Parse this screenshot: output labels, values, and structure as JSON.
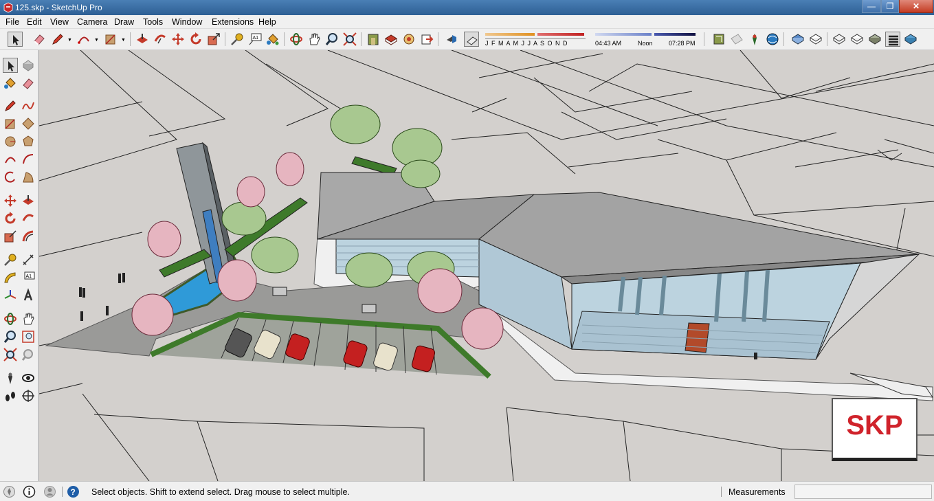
{
  "window": {
    "title": "125.skp - SketchUp Pro",
    "controls": [
      "minimize-icon",
      "maximize-icon",
      "close-icon"
    ]
  },
  "menu": [
    "File",
    "Edit",
    "View",
    "Camera",
    "Draw",
    "Tools",
    "Window",
    "Extensions",
    "Help"
  ],
  "shadows": {
    "months": "J F M A M J J A S O N D",
    "time_start": "04:43 AM",
    "time_mid": "Noon",
    "time_end": "07:28 PM"
  },
  "toolbar_icons": [
    "select-icon",
    "eraser-icon",
    "pencil-icon",
    "arc-icon",
    "rectangle-icon",
    "push-pull-icon",
    "follow-me-icon",
    "move-icon",
    "rotate-icon",
    "scale-icon",
    "tape-measure-icon",
    "text-icon",
    "paint-bucket-icon",
    "orbit-icon",
    "pan-icon",
    "zoom-icon",
    "zoom-extents-icon",
    "warehouse-icon",
    "model-info-icon",
    "extension-warehouse-icon",
    "send-to-layout-icon",
    "shadows-icon",
    "fog-icon",
    "geo-location-icon",
    "section-plane-icon",
    "camera-position-icon",
    "photo-texture-icon",
    "xray-icon",
    "back-edges-icon",
    "wireframe-icon",
    "hidden-line-icon",
    "shaded-icon",
    "shaded-textures-icon",
    "monochrome-icon"
  ],
  "left_toolbar_icons": [
    "select-icon",
    "make-component-icon",
    "paint-bucket-icon",
    "eraser-icon",
    "line-icon",
    "freehand-icon",
    "rectangle-icon",
    "rotated-rectangle-icon",
    "circle-icon",
    "polygon-icon",
    "arc-icon",
    "pie-icon",
    "three-point-arc-icon",
    "two-point-arc-icon",
    "move-icon",
    "push-pull-icon",
    "rotate-icon",
    "follow-me-icon",
    "scale-icon",
    "offset-icon",
    "tape-measure-icon",
    "dimension-icon",
    "protractor-icon",
    "text-icon",
    "axes-icon",
    "3d-text-icon",
    "orbit-icon",
    "pan-icon",
    "zoom-icon",
    "zoom-window-icon",
    "zoom-extents-icon",
    "previous-view-icon",
    "position-camera-icon",
    "look-around-icon",
    "walk-icon",
    "section-plane-icon"
  ],
  "viewport": {
    "watermark": "SKP"
  },
  "status": {
    "message": "Select objects. Shift to extend select. Drag mouse to select multiple.",
    "measurements_label": "Measurements",
    "measurements_value": ""
  }
}
